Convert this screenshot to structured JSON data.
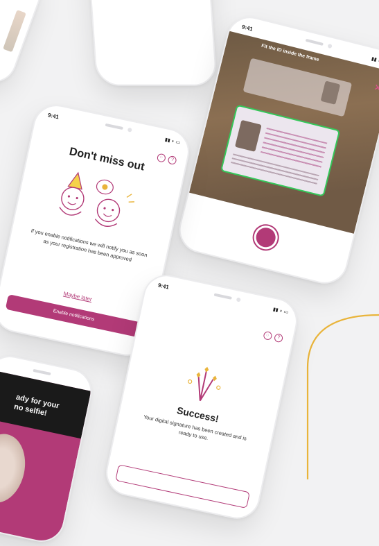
{
  "colors": {
    "accent": "#b23a77",
    "gold": "#e9b43a",
    "background": "#f2f2f3"
  },
  "notifications_phone": {
    "time": "9:41",
    "title": "Don't miss out",
    "body": "If you enable notifications we will notify you as soon as your registration has been approved",
    "maybe_later": "Maybe later",
    "enable_button": "Enable notifications",
    "icons": [
      "chat-icon",
      "help-icon"
    ]
  },
  "scan_phone": {
    "time": "9:41",
    "instruction": "Fit the ID inside the frame",
    "close": "✕"
  },
  "success_phone": {
    "time": "9:41",
    "title": "Success!",
    "body": "Your digital signature has been created and is ready to use.",
    "icons": [
      "chat-icon",
      "help-icon"
    ]
  },
  "selfie_phone": {
    "title": "ady for your\nno selfie!"
  }
}
